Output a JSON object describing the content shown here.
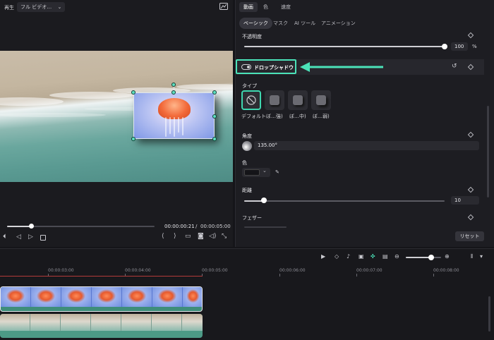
{
  "player": {
    "label": "再生",
    "quality": "フル ビデオ…",
    "quality_caret": "⌄",
    "time_current": "00:00:00:21",
    "time_sep": "/",
    "time_total": "00:00:05:00",
    "progress": 0.16
  },
  "panel": {
    "tabs": [
      "動画",
      "色",
      "速度"
    ],
    "subtabs": [
      "ベーシック",
      "マスク",
      "AI ツール",
      "アニメーション"
    ],
    "opacity": {
      "label": "不透明度",
      "value": "100",
      "unit": "%",
      "level": 1.0
    },
    "drop_shadow": {
      "label": "ドロップシャドウ",
      "enabled": true
    },
    "type": {
      "label": "タイプ",
      "options": [
        "デフォルト",
        "ぼ…強)",
        "ぼ…中)",
        "ぼ…弱)"
      ],
      "selected": 0
    },
    "angle": {
      "label": "角度",
      "value": "135.00°"
    },
    "color": {
      "label": "色",
      "swatch": "#141418"
    },
    "distance": {
      "label": "距離",
      "value": "10",
      "level": 0.1
    },
    "feather": {
      "label": "フェザー"
    },
    "reset_label": "リセット"
  },
  "timeline": {
    "ruler": [
      "00:00:03:00",
      "00:00:04:00",
      "00:00:05:00",
      "00:00:06:00",
      "00:00:07:00",
      "00:00:08:00"
    ]
  },
  "colors": {
    "accent": "#4be3b9",
    "playhead_red": "#b33a3a",
    "track_green": "#3e8e7a"
  }
}
